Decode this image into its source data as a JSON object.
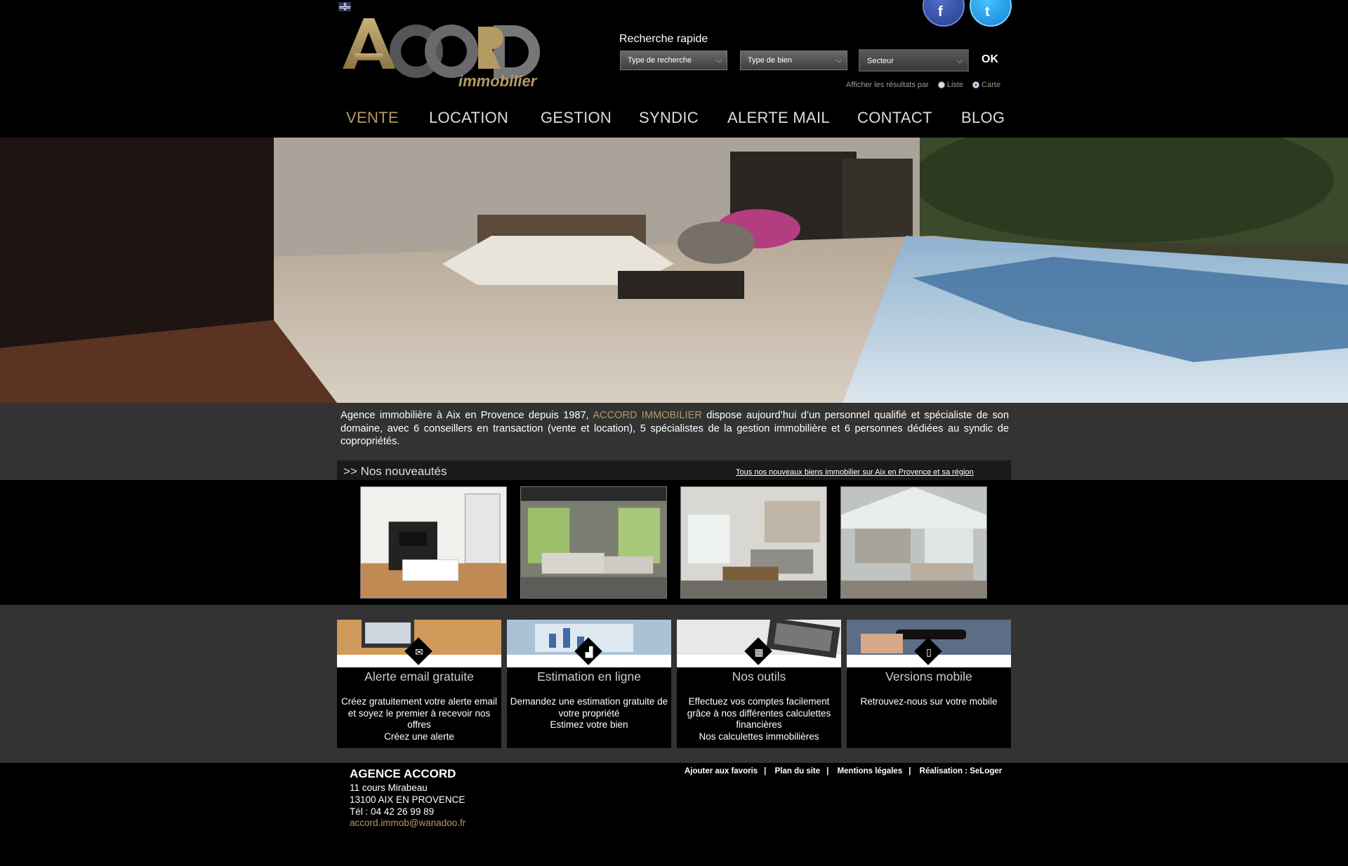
{
  "header": {
    "logo_text": "ACCORD",
    "logo_sub": "immobilier",
    "quick_search_title": "Recherche rapide",
    "search_type_select": "Type de recherche",
    "property_type_select": "Type de bien",
    "sector_select": "Secteur",
    "ok_label": "OK",
    "display_label": "Afficher les résultats par",
    "display_list": "Liste",
    "display_map": "Carte",
    "display_selected": "Carte"
  },
  "nav": {
    "items": [
      {
        "label": "VENTE",
        "active": true
      },
      {
        "label": "LOCATION",
        "active": false
      },
      {
        "label": "GESTION",
        "active": false
      },
      {
        "label": "SYNDIC",
        "active": false
      },
      {
        "label": "ALERTE MAIL",
        "active": false
      },
      {
        "label": "CONTACT",
        "active": false
      },
      {
        "label": "BLOG",
        "active": false
      }
    ]
  },
  "intro": {
    "part1": "Agence immobilière à Aix en Provence depuis 1987, ",
    "highlight": "ACCORD IMMOBILIER",
    "part2": " dispose aujourd’hui d’un personnel qualifié et spécialiste de son domaine, avec 6 conseillers en transaction (vente et location), 5 spécialistes de la gestion immobilière et 6 personnes dédiées au syndic de copropriétés."
  },
  "news": {
    "title": ">> Nos nouveautés",
    "link": "Tous nos nouveaux biens immobilier sur Aix en Provence et sa région"
  },
  "features": [
    {
      "title": "Alerte email gratuite",
      "text": "Créez gratuitement votre alerte email et soyez le premier à recevoir nos offres",
      "link": "Créez une alerte",
      "icon": "envelope-icon"
    },
    {
      "title": "Estimation en ligne",
      "text": "Demandez une estimation gratuite de votre propriété",
      "link": "Estimez votre bien",
      "icon": "chart-icon"
    },
    {
      "title": "Nos outils",
      "text": "Effectuez vos comptes facilement grâce à nos différentes calculettes financières",
      "link": "Nos calculettes immobilières",
      "icon": "calculator-icon"
    },
    {
      "title": "Versions mobile",
      "text": "Retrouvez-nous sur votre mobile",
      "link": "",
      "icon": "mobile-icon"
    }
  ],
  "footer": {
    "name": "AGENCE ACCORD",
    "street": "11 cours Mirabeau",
    "city": "13100 AIX EN PROVENCE",
    "phone": "Tél : 04 42 26 99 89",
    "email": "accord.immob@wanadoo.fr",
    "links": [
      "Ajouter aux favoris",
      "Plan du site",
      "Mentions légales",
      "Réalisation : SeLoger"
    ]
  },
  "colors": {
    "accent": "#b49a63",
    "background": "#000000",
    "band": "#333333"
  }
}
